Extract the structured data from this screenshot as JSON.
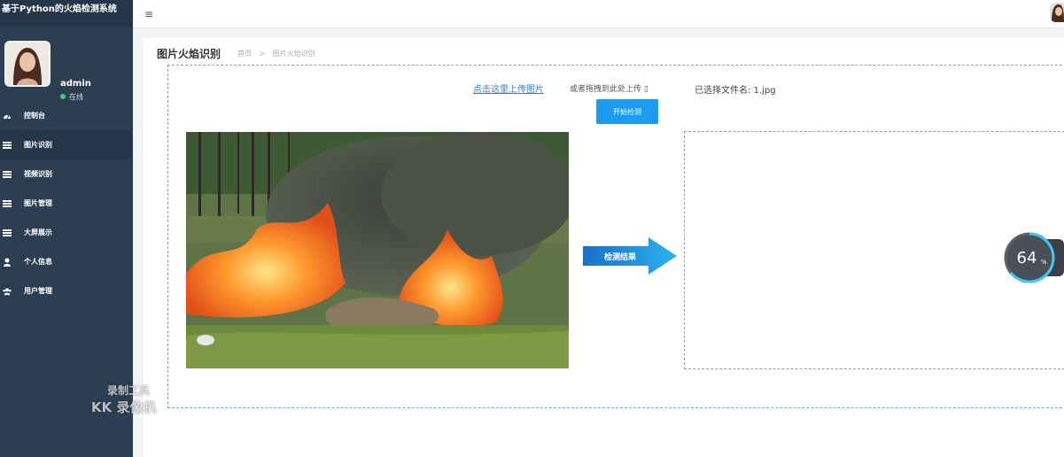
{
  "app": {
    "title": "基于Python的火焰检测系统"
  },
  "sidebar": {
    "user": {
      "name": "admin",
      "status": "在线"
    },
    "items": [
      {
        "label": "控制台",
        "icon": "dashboard-icon"
      },
      {
        "label": "图片识别",
        "icon": "list-icon",
        "active": true
      },
      {
        "label": "视频识别",
        "icon": "list-icon"
      },
      {
        "label": "图片管理",
        "icon": "list-icon"
      },
      {
        "label": "大屏展示",
        "icon": "list-icon"
      },
      {
        "label": "个人信息",
        "icon": "user-icon"
      },
      {
        "label": "用户管理",
        "icon": "users-icon"
      }
    ]
  },
  "topbar": {
    "menu_icon": "≡"
  },
  "page": {
    "title": "图片火焰识别",
    "breadcrumb": [
      "首页",
      ">",
      "图片火焰识别"
    ]
  },
  "upload": {
    "link_label": "点击这里上传图片",
    "drag_hint": "或者拖拽到此处上传 ▯",
    "selected_file": "已选择文件名: 1.jpg",
    "start_button": "开始检测"
  },
  "result": {
    "arrow_label": "检测结果"
  },
  "widget": {
    "percent": "64",
    "unit": "%"
  },
  "watermark": {
    "line1": "录制工具",
    "line2": "KK 录像机"
  },
  "colors": {
    "sidebar": "#2c3f52",
    "accent": "#1d9bf0",
    "link": "#2f7fd1"
  }
}
